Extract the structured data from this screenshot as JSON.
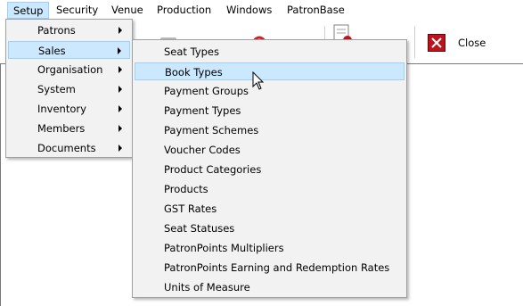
{
  "menubar": {
    "items": [
      {
        "label": "Setup"
      },
      {
        "label": "Security"
      },
      {
        "label": "Venue"
      },
      {
        "label": "Production"
      },
      {
        "label": "Windows"
      },
      {
        "label": "PatronBase"
      }
    ]
  },
  "toolbar": {
    "close_label": "Close",
    "close_icon": "close-icon",
    "accent": "#c0121c"
  },
  "setup_menu": {
    "items": [
      {
        "label": "Patrons"
      },
      {
        "label": "Sales"
      },
      {
        "label": "Organisation"
      },
      {
        "label": "System"
      },
      {
        "label": "Inventory"
      },
      {
        "label": "Members"
      },
      {
        "label": "Documents"
      }
    ],
    "highlight": "#cce8ff"
  },
  "sales_menu": {
    "items": [
      {
        "label": "Seat Types"
      },
      {
        "label": "Book Types"
      },
      {
        "label": "Payment Groups"
      },
      {
        "label": "Payment Types"
      },
      {
        "label": "Payment Schemes"
      },
      {
        "label": "Voucher Codes"
      },
      {
        "label": "Product Categories"
      },
      {
        "label": "Products"
      },
      {
        "label": "GST Rates"
      },
      {
        "label": "Seat Statuses"
      },
      {
        "label": "PatronPoints Multipliers"
      },
      {
        "label": "PatronPoints Earning and Redemption Rates"
      },
      {
        "label": "Units of Measure"
      }
    ]
  }
}
